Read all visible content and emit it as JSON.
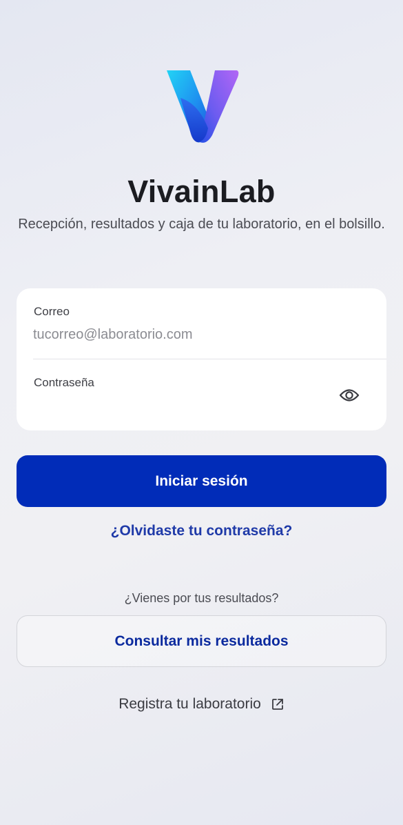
{
  "app": {
    "title": "VivainLab",
    "tagline": "Recepción, resultados y caja de tu laboratorio, en el bolsillo."
  },
  "login_form": {
    "email": {
      "label": "Correo",
      "placeholder": "tucorreo@laboratorio.com",
      "value": ""
    },
    "password": {
      "label": "Contraseña",
      "value": "",
      "toggle_icon": "eye-icon"
    }
  },
  "actions": {
    "login_label": "Iniciar sesión",
    "forgot_password_label": "¿Olvidaste tu contraseña?",
    "results_question": "¿Vienes por tus resultados?",
    "results_button_label": "Consultar mis resultados",
    "register_label": "Registra tu laboratorio",
    "register_icon": "external-link-icon"
  },
  "colors": {
    "primary": "#012cb8",
    "link": "#1f3aa8",
    "logo_gradient": [
      "#22d3f5",
      "#2563eb",
      "#a855f7"
    ]
  }
}
